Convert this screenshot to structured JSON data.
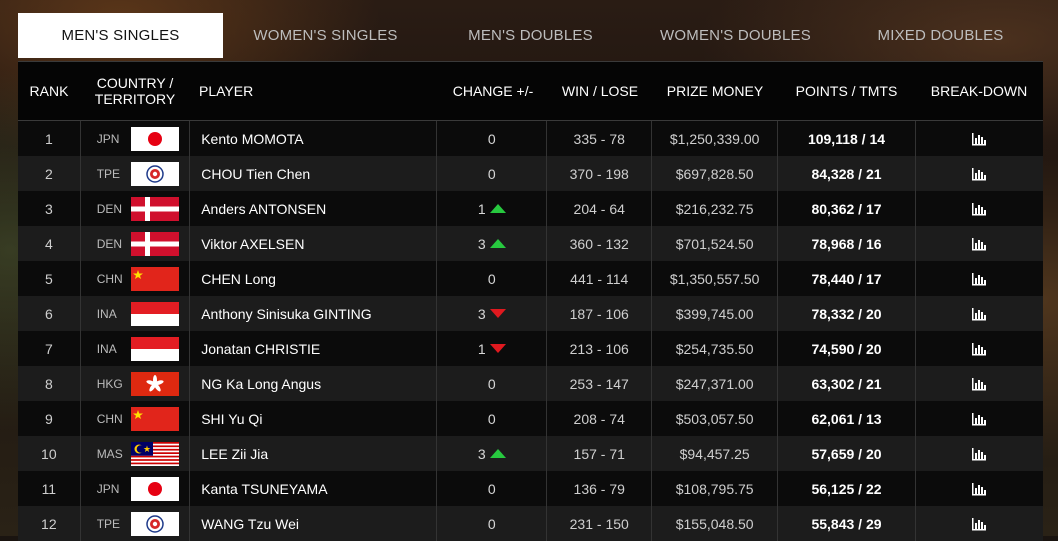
{
  "tabs": [
    "MEN'S SINGLES",
    "WOMEN'S SINGLES",
    "MEN'S DOUBLES",
    "WOMEN'S DOUBLES",
    "MIXED DOUBLES"
  ],
  "active_tab": 0,
  "headers": {
    "rank": "RANK",
    "country_line1": "COUNTRY /",
    "country_line2": "TERRITORY",
    "player": "PLAYER",
    "change": "CHANGE +/-",
    "win_lose": "WIN / LOSE",
    "prize": "PRIZE MONEY",
    "points": "POINTS / TMTS",
    "breakdown": "BREAK-DOWN"
  },
  "rows": [
    {
      "rank": "1",
      "country": "JPN",
      "flag": "jpn",
      "player": "Kento MOMOTA",
      "change": "0",
      "trend": "none",
      "wl": "335 - 78",
      "prize": "$1,250,339.00",
      "points": "109,118 / 14"
    },
    {
      "rank": "2",
      "country": "TPE",
      "flag": "tpe",
      "player": "CHOU Tien Chen",
      "change": "0",
      "trend": "none",
      "wl": "370 - 198",
      "prize": "$697,828.50",
      "points": "84,328 / 21"
    },
    {
      "rank": "3",
      "country": "DEN",
      "flag": "den",
      "player": "Anders ANTONSEN",
      "change": "1",
      "trend": "up",
      "wl": "204 - 64",
      "prize": "$216,232.75",
      "points": "80,362 / 17"
    },
    {
      "rank": "4",
      "country": "DEN",
      "flag": "den",
      "player": "Viktor AXELSEN",
      "change": "3",
      "trend": "up",
      "wl": "360 - 132",
      "prize": "$701,524.50",
      "points": "78,968 / 16"
    },
    {
      "rank": "5",
      "country": "CHN",
      "flag": "chn",
      "player": "CHEN Long",
      "change": "0",
      "trend": "none",
      "wl": "441 - 114",
      "prize": "$1,350,557.50",
      "points": "78,440 / 17"
    },
    {
      "rank": "6",
      "country": "INA",
      "flag": "ina",
      "player": "Anthony Sinisuka GINTING",
      "change": "3",
      "trend": "down",
      "wl": "187 - 106",
      "prize": "$399,745.00",
      "points": "78,332 / 20"
    },
    {
      "rank": "7",
      "country": "INA",
      "flag": "ina",
      "player": "Jonatan CHRISTIE",
      "change": "1",
      "trend": "down",
      "wl": "213 - 106",
      "prize": "$254,735.50",
      "points": "74,590 / 20"
    },
    {
      "rank": "8",
      "country": "HKG",
      "flag": "hkg",
      "player": "NG Ka Long Angus",
      "change": "0",
      "trend": "none",
      "wl": "253 - 147",
      "prize": "$247,371.00",
      "points": "63,302 / 21"
    },
    {
      "rank": "9",
      "country": "CHN",
      "flag": "chn",
      "player": "SHI Yu Qi",
      "change": "0",
      "trend": "none",
      "wl": "208 - 74",
      "prize": "$503,057.50",
      "points": "62,061 / 13"
    },
    {
      "rank": "10",
      "country": "MAS",
      "flag": "mas",
      "player": "LEE Zii Jia",
      "change": "3",
      "trend": "up",
      "wl": "157 - 71",
      "prize": "$94,457.25",
      "points": "57,659 / 20"
    },
    {
      "rank": "11",
      "country": "JPN",
      "flag": "jpn",
      "player": "Kanta TSUNEYAMA",
      "change": "0",
      "trend": "none",
      "wl": "136 - 79",
      "prize": "$108,795.75",
      "points": "56,125 / 22"
    },
    {
      "rank": "12",
      "country": "TPE",
      "flag": "tpe",
      "player": "WANG Tzu Wei",
      "change": "0",
      "trend": "none",
      "wl": "231 - 150",
      "prize": "$155,048.50",
      "points": "55,843 / 29"
    }
  ],
  "colors": {
    "up": "#27c93f",
    "down": "#e0191f"
  }
}
